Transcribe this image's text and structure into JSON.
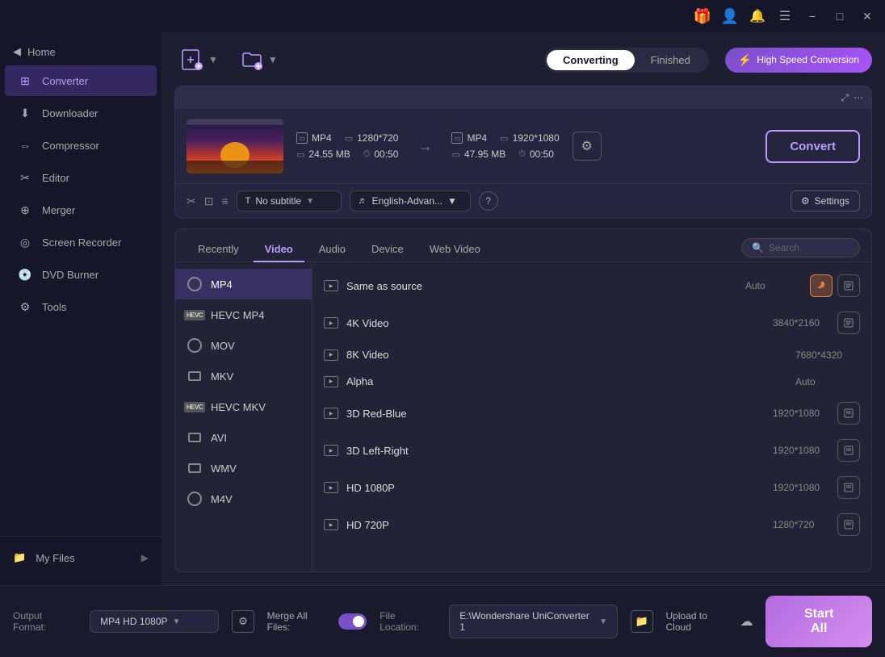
{
  "titlebar": {
    "window_controls": {
      "minimize": "−",
      "maximize": "□",
      "close": "✕"
    }
  },
  "sidebar": {
    "toggle_label": "Home",
    "items": [
      {
        "id": "converter",
        "label": "Converter",
        "active": true
      },
      {
        "id": "downloader",
        "label": "Downloader",
        "active": false
      },
      {
        "id": "compressor",
        "label": "Compressor",
        "active": false
      },
      {
        "id": "editor",
        "label": "Editor",
        "active": false
      },
      {
        "id": "merger",
        "label": "Merger",
        "active": false
      },
      {
        "id": "screen-recorder",
        "label": "Screen Recorder",
        "active": false
      },
      {
        "id": "dvd-burner",
        "label": "DVD Burner",
        "active": false
      },
      {
        "id": "tools",
        "label": "Tools",
        "active": false
      }
    ],
    "my_files_label": "My Files"
  },
  "toolbar": {
    "tab_converting": "Converting",
    "tab_finished": "Finished",
    "speed_btn": "High Speed Conversion"
  },
  "file_card": {
    "src_format": "MP4",
    "src_resolution": "1280*720",
    "src_size": "24.55 MB",
    "src_duration": "00:50",
    "dst_format": "MP4",
    "dst_resolution": "1920*1080",
    "dst_size": "47.95 MB",
    "dst_duration": "00:50",
    "convert_btn": "Convert",
    "subtitle_placeholder": "No subtitle",
    "audio_placeholder": "English-Advan...",
    "settings_btn": "Settings"
  },
  "format_panel": {
    "tabs": [
      {
        "id": "recently",
        "label": "Recently",
        "active": false
      },
      {
        "id": "video",
        "label": "Video",
        "active": true
      },
      {
        "id": "audio",
        "label": "Audio",
        "active": false
      },
      {
        "id": "device",
        "label": "Device",
        "active": false
      },
      {
        "id": "web-video",
        "label": "Web Video",
        "active": false
      }
    ],
    "search_placeholder": "Search",
    "formats": [
      {
        "id": "mp4",
        "label": "MP4",
        "icon": "circle",
        "active": true
      },
      {
        "id": "hevc-mp4",
        "label": "HEVC MP4",
        "icon": "hevc",
        "active": false
      },
      {
        "id": "mov",
        "label": "MOV",
        "icon": "circle",
        "active": false
      },
      {
        "id": "mkv",
        "label": "MKV",
        "icon": "rect",
        "active": false
      },
      {
        "id": "hevc-mkv",
        "label": "HEVC MKV",
        "icon": "hevc",
        "active": false
      },
      {
        "id": "avi",
        "label": "AVI",
        "icon": "rect",
        "active": false
      },
      {
        "id": "wmv",
        "label": "WMV",
        "icon": "rect",
        "active": false
      },
      {
        "id": "m4v",
        "label": "M4V",
        "icon": "circle",
        "active": false
      }
    ],
    "qualities": [
      {
        "id": "same-as-source",
        "label": "Same as source",
        "resolution": "Auto",
        "has_action": true,
        "action_orange": true
      },
      {
        "id": "4k-video",
        "label": "4K Video",
        "resolution": "3840*2160",
        "has_action": true,
        "action_orange": false
      },
      {
        "id": "8k-video",
        "label": "8K Video",
        "resolution": "7680*4320",
        "has_action": false,
        "action_orange": false
      },
      {
        "id": "alpha",
        "label": "Alpha",
        "resolution": "Auto",
        "has_action": false,
        "action_orange": false
      },
      {
        "id": "3d-red-blue",
        "label": "3D Red-Blue",
        "resolution": "1920*1080",
        "has_action": true,
        "action_orange": false
      },
      {
        "id": "3d-left-right",
        "label": "3D Left-Right",
        "resolution": "1920*1080",
        "has_action": true,
        "action_orange": false
      },
      {
        "id": "hd-1080p",
        "label": "HD 1080P",
        "resolution": "1920*1080",
        "has_action": true,
        "action_orange": false
      },
      {
        "id": "hd-720p",
        "label": "HD 720P",
        "resolution": "1280*720",
        "has_action": true,
        "action_orange": false
      }
    ]
  },
  "bottom_bar": {
    "output_format_label": "Output Format:",
    "output_format_value": "MP4 HD 1080P",
    "merge_label": "Merge All Files:",
    "file_location_label": "File Location:",
    "file_location_value": "E:\\Wondershare UniConverter 1",
    "upload_cloud_label": "Upload to Cloud",
    "start_all_btn": "Start All"
  },
  "colors": {
    "accent": "#c09bff",
    "accent_dark": "#7b4fc8",
    "orange": "#e87d3c",
    "sidebar_bg": "#16162a",
    "content_bg": "#1e1e32",
    "card_bg": "#252540"
  }
}
